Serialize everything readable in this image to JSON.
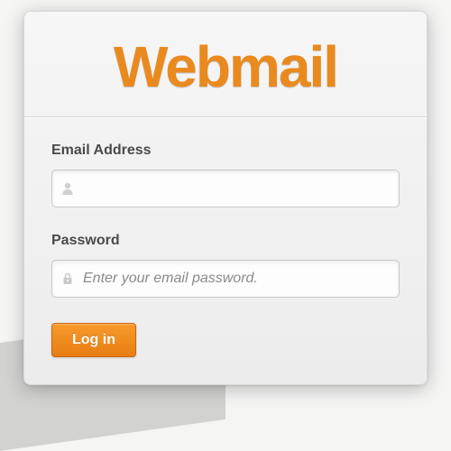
{
  "logo": {
    "text": "Webmail"
  },
  "form": {
    "email": {
      "label": "Email Address",
      "value": "",
      "placeholder": ""
    },
    "password": {
      "label": "Password",
      "value": "",
      "placeholder": "Enter your email password."
    },
    "submit": {
      "label": "Log in"
    }
  },
  "colors": {
    "accent": "#e98a1f",
    "button": "#f08a1e"
  }
}
